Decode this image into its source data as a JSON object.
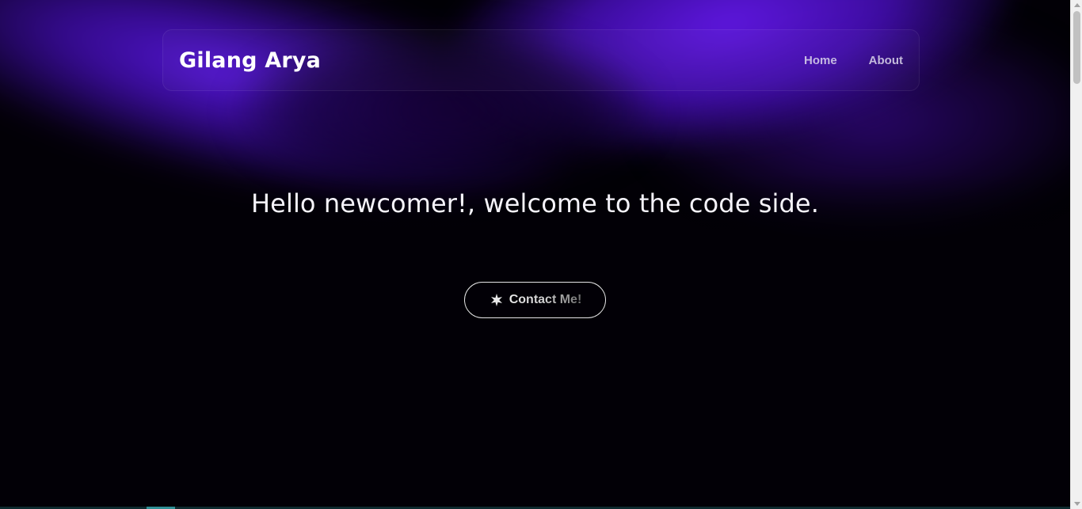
{
  "header": {
    "brand": "Gilang Arya",
    "nav": [
      {
        "label": "Home"
      },
      {
        "label": "About"
      }
    ]
  },
  "hero": {
    "title": "Hello newcomer!, welcome to the code side.",
    "cta": {
      "label": "Contact Me!",
      "icon": "sparkle-icon"
    }
  },
  "colors": {
    "background": "#020006",
    "accent": "#5c18e6",
    "text": "#ffffff"
  }
}
